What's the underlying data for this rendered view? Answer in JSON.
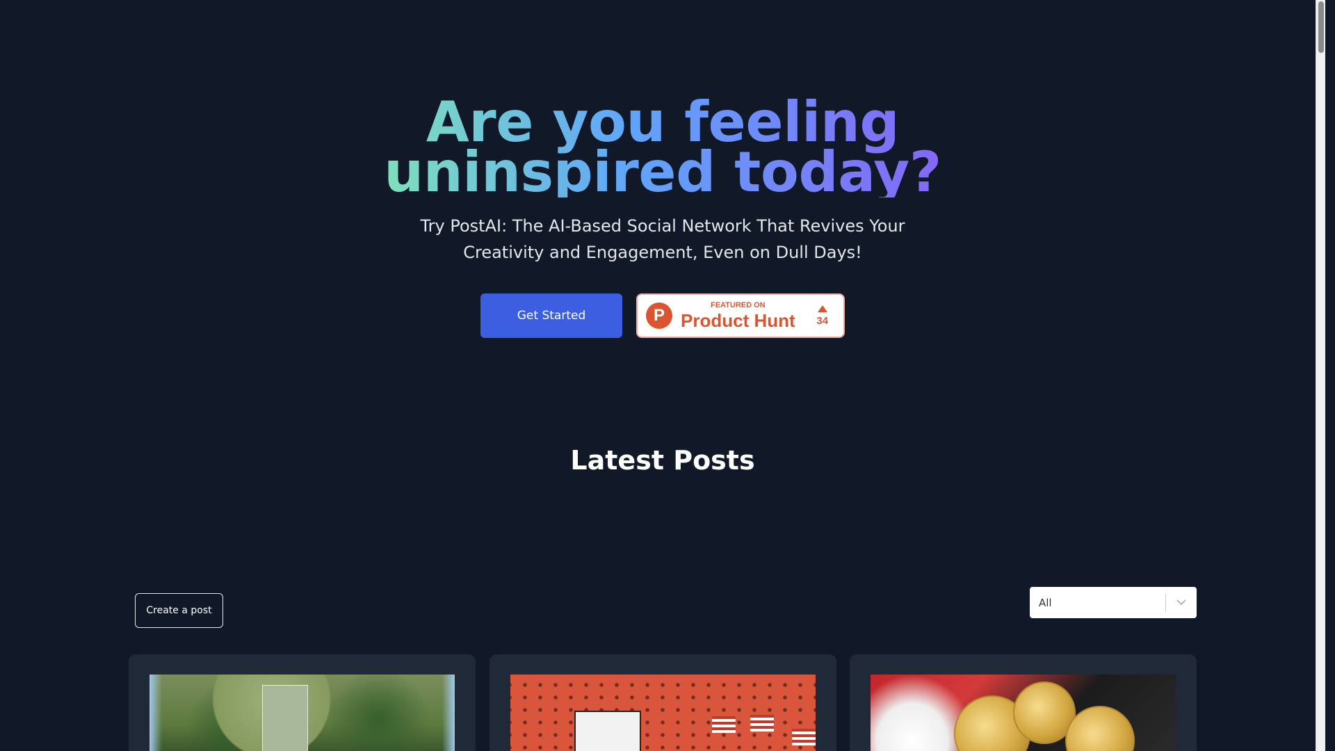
{
  "hero": {
    "headline": "Are you feeling uninspired today?",
    "subtitle": "Try PostAI: The AI-Based Social Network That Revives Your Creativity and Engagement, Even on Dull Days!",
    "get_started_label": "Get Started",
    "product_hunt": {
      "letter": "P",
      "featured_on": "FEATURED ON",
      "name": "Product Hunt",
      "votes": "34"
    }
  },
  "posts": {
    "section_title": "Latest Posts",
    "create_label": "Create a post",
    "filter": {
      "selected": "All"
    },
    "cards": [
      {
        "image": "aerial-park-image"
      },
      {
        "image": "red-ship-hull-image"
      },
      {
        "image": "gold-coins-santa-image"
      }
    ]
  },
  "colors": {
    "background": "#111827",
    "card": "#1f2937",
    "primary_button": "#3b5fe0",
    "product_hunt": "#da552f",
    "gradient": [
      "#86efac",
      "#60a5fa",
      "#8b5cf6"
    ]
  }
}
